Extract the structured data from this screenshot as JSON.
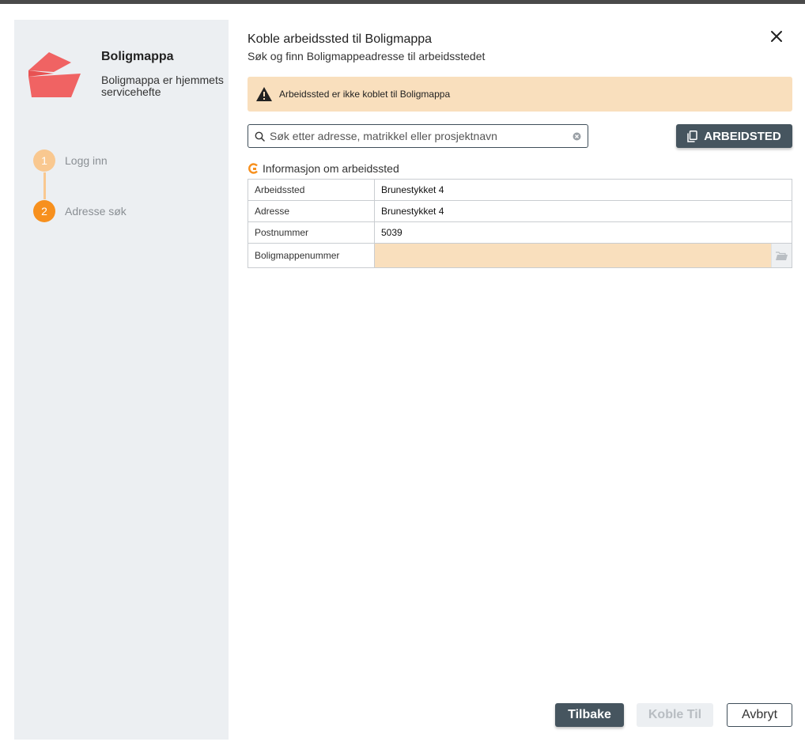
{
  "brand": {
    "name": "Boligmappa",
    "description": "Boligmappa er hjemmets servicehefte",
    "logo_color": "#f06363"
  },
  "steps": [
    {
      "number": "1",
      "label": "Logg inn",
      "state": "completed",
      "color": "#f9c890"
    },
    {
      "number": "2",
      "label": "Adresse søk",
      "state": "active",
      "color": "#f7901e"
    }
  ],
  "dialog": {
    "title": "Koble arbeidssted til Boligmappa",
    "subtitle": "Søk og finn Boligmappeadresse til arbeidsstedet",
    "close_icon": "close-icon"
  },
  "alert": {
    "text": "Arbeidssted er ikke koblet til Boligmappa",
    "icon": "warning-icon",
    "background": "#f9dfbd"
  },
  "search": {
    "placeholder": "Søk etter adresse, matrikkel eller prosjektnavn",
    "value": ""
  },
  "arbeidsted_button": {
    "label": "ARBEIDSTED",
    "icon": "copy-icon"
  },
  "info": {
    "heading": "Informasjon om arbeidssted",
    "rows": [
      {
        "key": "Arbeidssted",
        "value": "Brunestykket 4"
      },
      {
        "key": "Adresse",
        "value": "Brunestykket 4"
      },
      {
        "key": "Postnummer",
        "value": "5039"
      },
      {
        "key": "Boligmappenummer",
        "value": ""
      }
    ]
  },
  "footer": {
    "back_label": "Tilbake",
    "connect_label": "Koble Til",
    "cancel_label": "Avbryt"
  },
  "colors": {
    "primary_dark": "#46555f",
    "accent_orange": "#f7901e",
    "sidebar_bg": "#eceff2"
  }
}
